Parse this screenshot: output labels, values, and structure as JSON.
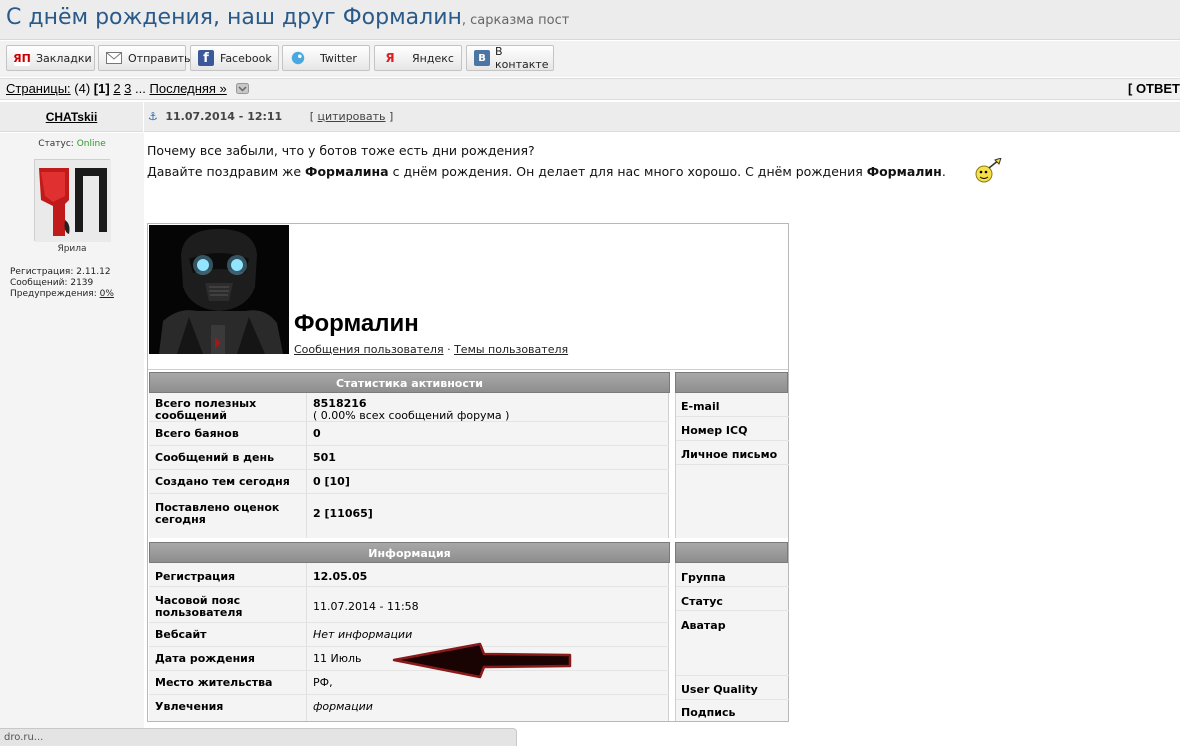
{
  "topic": {
    "title": "С днём рождения, наш друг Формалин",
    "subtitle": ", сарказма пост"
  },
  "share": [
    {
      "label": "Закладки",
      "icon": "yap-icon",
      "color": "#cc0000"
    },
    {
      "label": "Отправить",
      "icon": "mail-icon",
      "color": "#ffffff"
    },
    {
      "label": "Facebook",
      "icon": "facebook-icon",
      "color": "#3b5998"
    },
    {
      "label": "Twitter",
      "icon": "twitter-icon",
      "color": "#4aa8e0"
    },
    {
      "label": "Яндекс",
      "icon": "yandex-icon",
      "color": "#ffffff"
    },
    {
      "label": "В контакте",
      "icon": "vk-icon",
      "color": "#4c75a3"
    }
  ],
  "pagination": {
    "label": "Страницы:",
    "count": "(4)",
    "current": "[1]",
    "p2": "2",
    "p3": "3",
    "ellipsis": "...",
    "last": "Последняя »",
    "reply": "[ ОТВЕТ"
  },
  "post": {
    "author": "CHATskii",
    "anchor_icon": "anchor-icon",
    "date": "11.07.2014 - 12:11",
    "quote_open": "[",
    "quote": "цитировать",
    "quote_close": "]",
    "line1": "Почему все забыли, что у ботов тоже есть дни рождения?",
    "line2_a": "Давайте поздравим же ",
    "line2_b": "Формалина",
    "line2_c": " с днём рождения. Он делает для нас много хорошо. С днём рождения ",
    "line2_d": "Формалин",
    "line2_e": "."
  },
  "author_panel": {
    "status_label": "Статус: ",
    "status_value": "Online",
    "avatar_text": "ЯП",
    "avatar_name": "Ярила",
    "reg": "Регистрация: 2.11.12",
    "msgs": "Сообщений: 2139",
    "warn_label": "Предупреждения: ",
    "warn_value": "0%"
  },
  "profile": {
    "name": "Формалин",
    "link1": "Сообщения пользователя",
    "sep": " · ",
    "link2": "Темы пользователя",
    "stats_header": "Статистика активности",
    "info_header": "Информация",
    "stats": [
      {
        "label": "Всего полезных сообщений",
        "value": "8518216",
        "note": "( 0.00% всех сообщений форума )"
      },
      {
        "label": "Всего баянов",
        "value": "0"
      },
      {
        "label": "Сообщений в день",
        "value": "501"
      },
      {
        "label": "Создано тем сегодня",
        "value": "0 [10]"
      },
      {
        "label": "Поставлено оценок сегодня",
        "value": "2 [11065]"
      }
    ],
    "contacts": [
      "E-mail",
      "Номер ICQ",
      "Личное письмо"
    ],
    "info": [
      {
        "label": "Регистрация",
        "value": "12.05.05"
      },
      {
        "label": "Часовой пояс пользователя",
        "value": "11.07.2014 - 11:58"
      },
      {
        "label": "Вебсайт",
        "value": "Нет информации"
      },
      {
        "label": "Дата рождения",
        "value": "11 Июль"
      },
      {
        "label": "Место жительства",
        "value": "РФ,"
      },
      {
        "label": "Увлечения",
        "value": "формации"
      }
    ],
    "extra": [
      "Группа",
      "Статус",
      "Аватар",
      "User Quality",
      "Подпись"
    ]
  },
  "statusbar": {
    "text": "dro.ru..."
  }
}
